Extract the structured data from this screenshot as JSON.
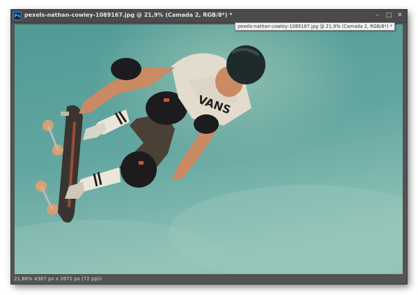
{
  "window": {
    "title": "pexels-nathan-cowley-1089167.jpg @ 21,9% (Camada 2, RGB/8*) *",
    "app_icon": "photoshop-document-icon",
    "app_icon_glyph": "Ps",
    "controls": {
      "minimize": "–",
      "maximize": "□",
      "close": "✕"
    }
  },
  "tooltip": {
    "text": "pexels-nathan-cowley-1089167.jpg @ 21,9% (Camada 2, RGB/8*) *"
  },
  "canvas": {
    "image_description_icon": "skateboarder-photo",
    "board_text": "VANS"
  },
  "status": {
    "zoom": "21,86%",
    "doc_info": "4387 px x 2871 px (72 ppi)",
    "arrow": "›"
  },
  "colors": {
    "window_bg": "#535353",
    "titlebar_bg": "#4a4a4a",
    "sky": "#5a9e9a",
    "sky_light": "#8dbfb4"
  }
}
